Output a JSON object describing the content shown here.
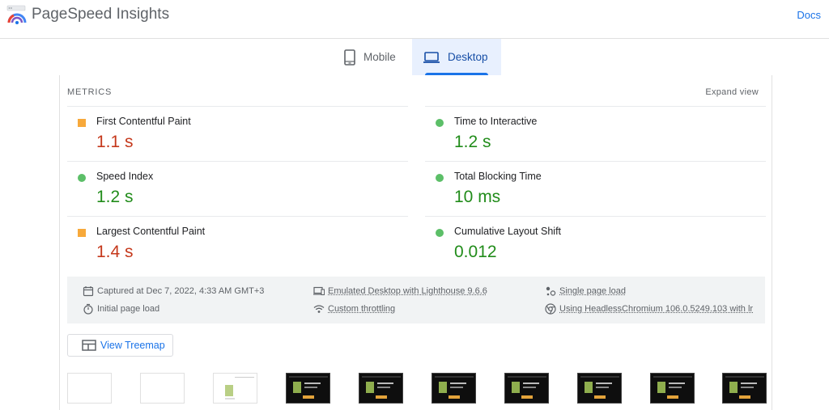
{
  "header": {
    "app_title": "PageSpeed Insights",
    "docs_label": "Docs"
  },
  "tabs": [
    {
      "label": "Mobile",
      "icon": "smartphone-icon",
      "selected": false
    },
    {
      "label": "Desktop",
      "icon": "laptop-icon",
      "selected": true
    }
  ],
  "metrics": {
    "section_label": "METRICS",
    "expand_label": "Expand view",
    "items": [
      {
        "name": "First Contentful Paint",
        "value": "1.1 s",
        "rating": "average"
      },
      {
        "name": "Time to Interactive",
        "value": "1.2 s",
        "rating": "good"
      },
      {
        "name": "Speed Index",
        "value": "1.2 s",
        "rating": "good"
      },
      {
        "name": "Total Blocking Time",
        "value": "10 ms",
        "rating": "good"
      },
      {
        "name": "Largest Contentful Paint",
        "value": "1.4 s",
        "rating": "average"
      },
      {
        "name": "Cumulative Layout Shift",
        "value": "0.012",
        "rating": "good"
      }
    ]
  },
  "info": {
    "captured": "Captured at Dec 7, 2022, 4:33 AM GMT+3",
    "initial_load": "Initial page load",
    "emulated": "Emulated Desktop with Lighthouse 9.6.6",
    "throttling": "Custom throttling",
    "single_page": "Single page load",
    "browser": "Using HeadlessChromium 106.0.5249.103 with lr"
  },
  "treemap": {
    "label": "View Treemap"
  },
  "colors": {
    "accent": "#1a73e8",
    "average": "#c5381b",
    "good": "#218c1a",
    "average_indicator": "#f7a93b",
    "good_indicator": "#5cbf68"
  }
}
